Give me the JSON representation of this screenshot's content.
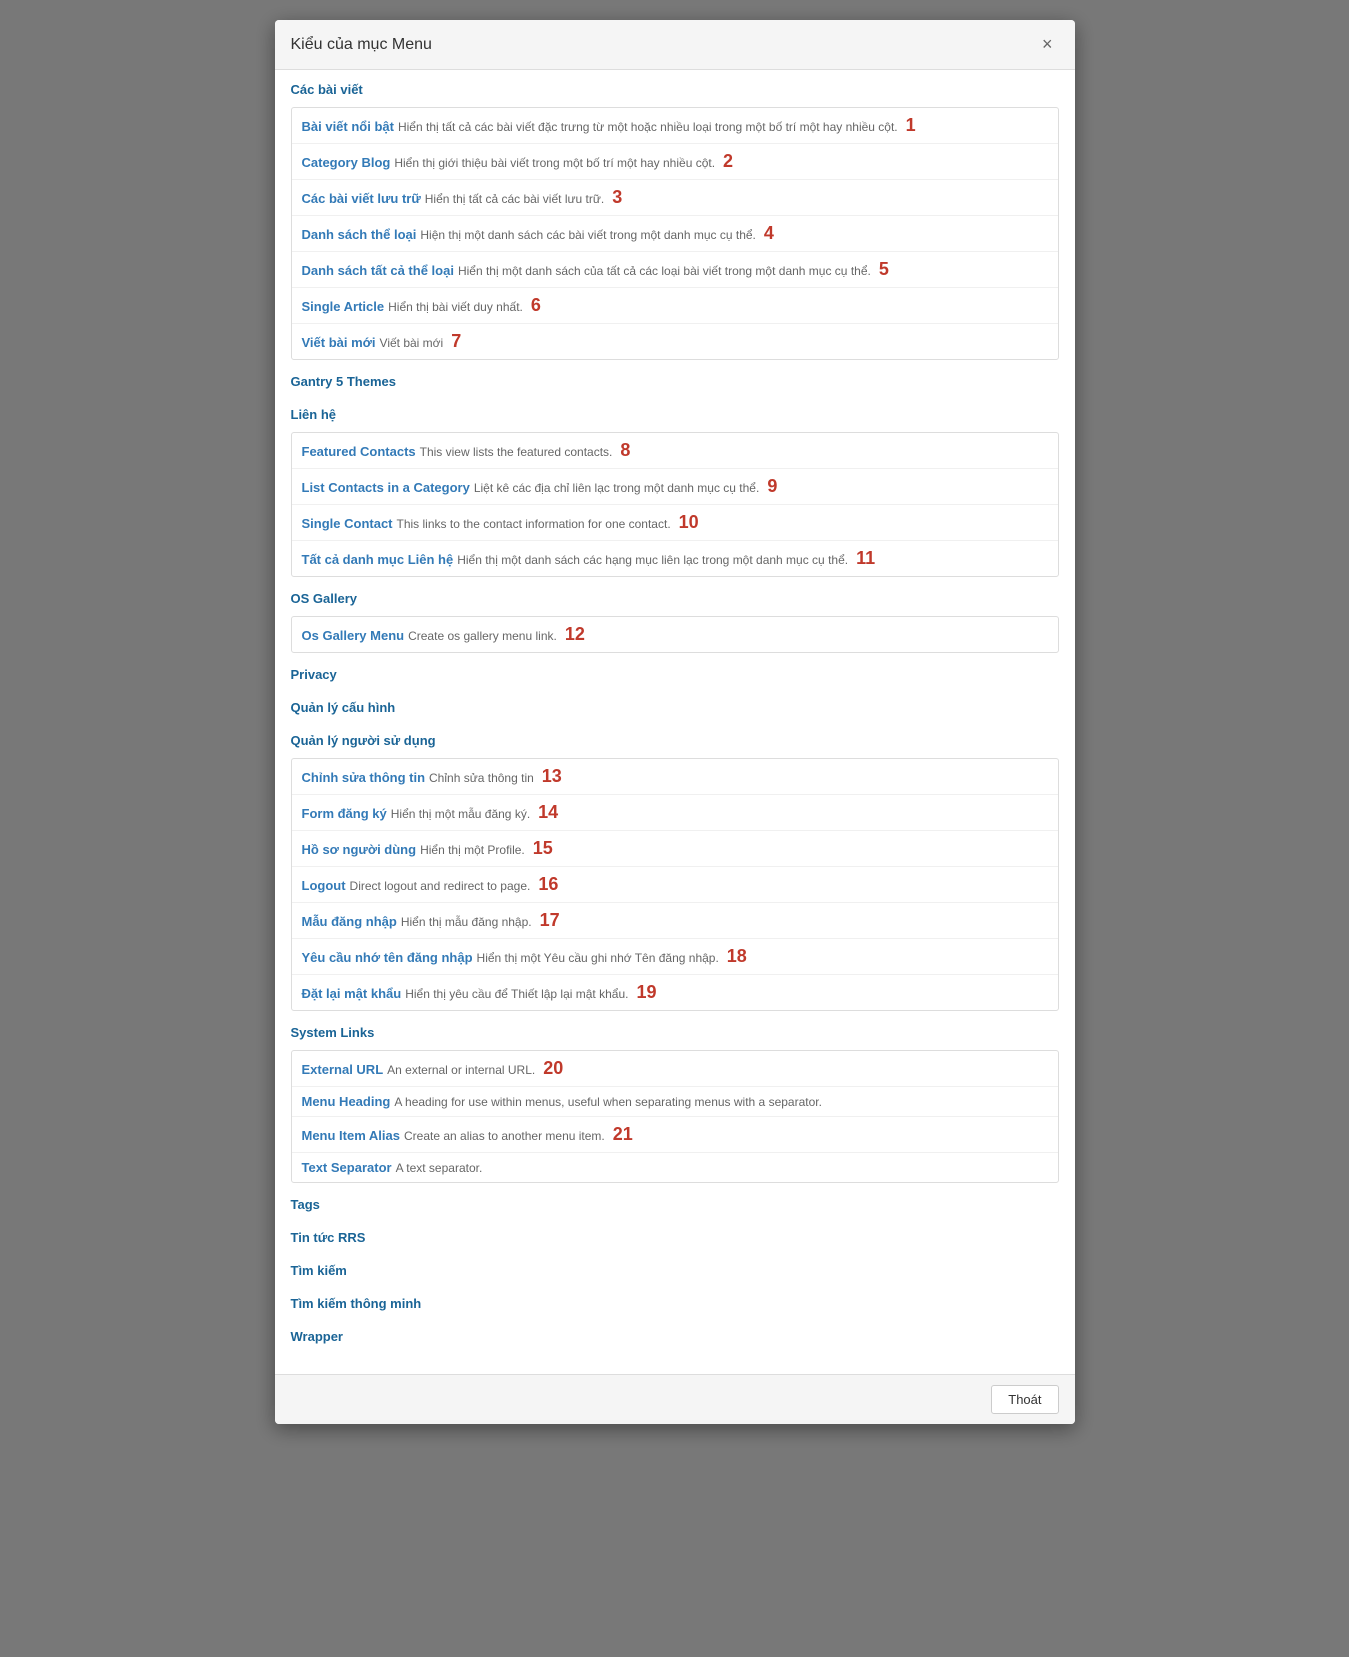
{
  "modal": {
    "title": "Kiểu của mục Menu",
    "close_label": "×",
    "footer_close": "Thoát"
  },
  "sections": [
    {
      "id": "bai-viet",
      "title": "Các bài viết",
      "items": [
        {
          "title": "Bài viết nổi bật",
          "desc": "Hiển thị tất cả các bài viết đặc trưng từ một hoặc nhiều loại trong một bố trí một hay nhiều cột.",
          "num": "1"
        },
        {
          "title": "Category Blog",
          "desc": "Hiển thị giới thiệu bài viết trong một bố trí một hay nhiều cột.",
          "num": "2"
        },
        {
          "title": "Các bài viết lưu trữ",
          "desc": "Hiển thị tất cả các bài viết lưu trữ.",
          "num": "3"
        },
        {
          "title": "Danh sách thể loại",
          "desc": "Hiện thị một danh sách các bài viết trong một danh mục cụ thể.",
          "num": "4"
        },
        {
          "title": "Danh sách tất cả thể loại",
          "desc": "Hiển thị một danh sách của tất cả các loại bài viết trong một danh mục cụ thể.",
          "num": "5"
        },
        {
          "title": "Single Article",
          "desc": "Hiển thị bài viết duy nhất.",
          "num": "6"
        },
        {
          "title": "Viết bài mới",
          "desc": "Viết bài mới",
          "num": "7"
        }
      ]
    },
    {
      "id": "gantry",
      "title": "Gantry 5 Themes",
      "items": []
    },
    {
      "id": "lien-he",
      "title": "Liên hệ",
      "items": [
        {
          "title": "Featured Contacts",
          "desc": "This view lists the featured contacts.",
          "num": "8"
        },
        {
          "title": "List Contacts in a Category",
          "desc": "Liệt kê các địa chỉ liên lạc trong một danh mục cụ thể.",
          "num": "9"
        },
        {
          "title": "Single Contact",
          "desc": "This links to the contact information for one contact.",
          "num": "10"
        },
        {
          "title": "Tất cả danh mục Liên hệ",
          "desc": "Hiển thị một danh sách các hạng mục liên lạc trong một danh mục cụ thể.",
          "num": "11"
        }
      ]
    },
    {
      "id": "os-gallery",
      "title": "OS Gallery",
      "items": [
        {
          "title": "Os Gallery Menu",
          "desc": "Create os gallery menu link.",
          "num": "12"
        }
      ]
    },
    {
      "id": "privacy",
      "title": "Privacy",
      "items": []
    },
    {
      "id": "quan-ly-cau-hinh",
      "title": "Quản lý cấu hình",
      "items": []
    },
    {
      "id": "quan-ly-nguoi-dung",
      "title": "Quản lý người sử dụng",
      "items": [
        {
          "title": "Chỉnh sửa thông tin",
          "desc": "Chỉnh sửa thông tin",
          "num": "13"
        },
        {
          "title": "Form đăng ký",
          "desc": "Hiển thị một mẫu đăng ký.",
          "num": "14"
        },
        {
          "title": "Hồ sơ người dùng",
          "desc": "Hiển thị một Profile.",
          "num": "15"
        },
        {
          "title": "Logout",
          "desc": "Direct logout and redirect to page.",
          "num": "16"
        },
        {
          "title": "Mẫu đăng nhập",
          "desc": "Hiển thị mẫu đăng nhập.",
          "num": "17"
        },
        {
          "title": "Yêu cầu nhớ tên đăng nhập",
          "desc": "Hiển thị một Yêu cầu ghi nhớ Tên đăng nhập.",
          "num": "18"
        },
        {
          "title": "Đặt lại mật khẩu",
          "desc": "Hiển thị yêu cầu để Thiết lập lại mật khẩu.",
          "num": "19"
        }
      ]
    },
    {
      "id": "system-links",
      "title": "System Links",
      "items": [
        {
          "title": "External URL",
          "desc": "An external or internal URL.",
          "num": "20"
        },
        {
          "title": "Menu Heading",
          "desc": "A heading for use within menus, useful when separating menus with a separator.",
          "num": ""
        },
        {
          "title": "Menu Item Alias",
          "desc": "Create an alias to another menu item.",
          "num": "21"
        },
        {
          "title": "Text Separator",
          "desc": "A text separator.",
          "num": ""
        }
      ]
    },
    {
      "id": "tags",
      "title": "Tags",
      "items": []
    },
    {
      "id": "tin-tuc-rrs",
      "title": "Tin tức RRS",
      "items": []
    },
    {
      "id": "tim-kiem",
      "title": "Tìm kiếm",
      "items": []
    },
    {
      "id": "tim-kiem-thong-minh",
      "title": "Tìm kiếm thông minh",
      "items": []
    },
    {
      "id": "wrapper",
      "title": "Wrapper",
      "items": []
    }
  ]
}
